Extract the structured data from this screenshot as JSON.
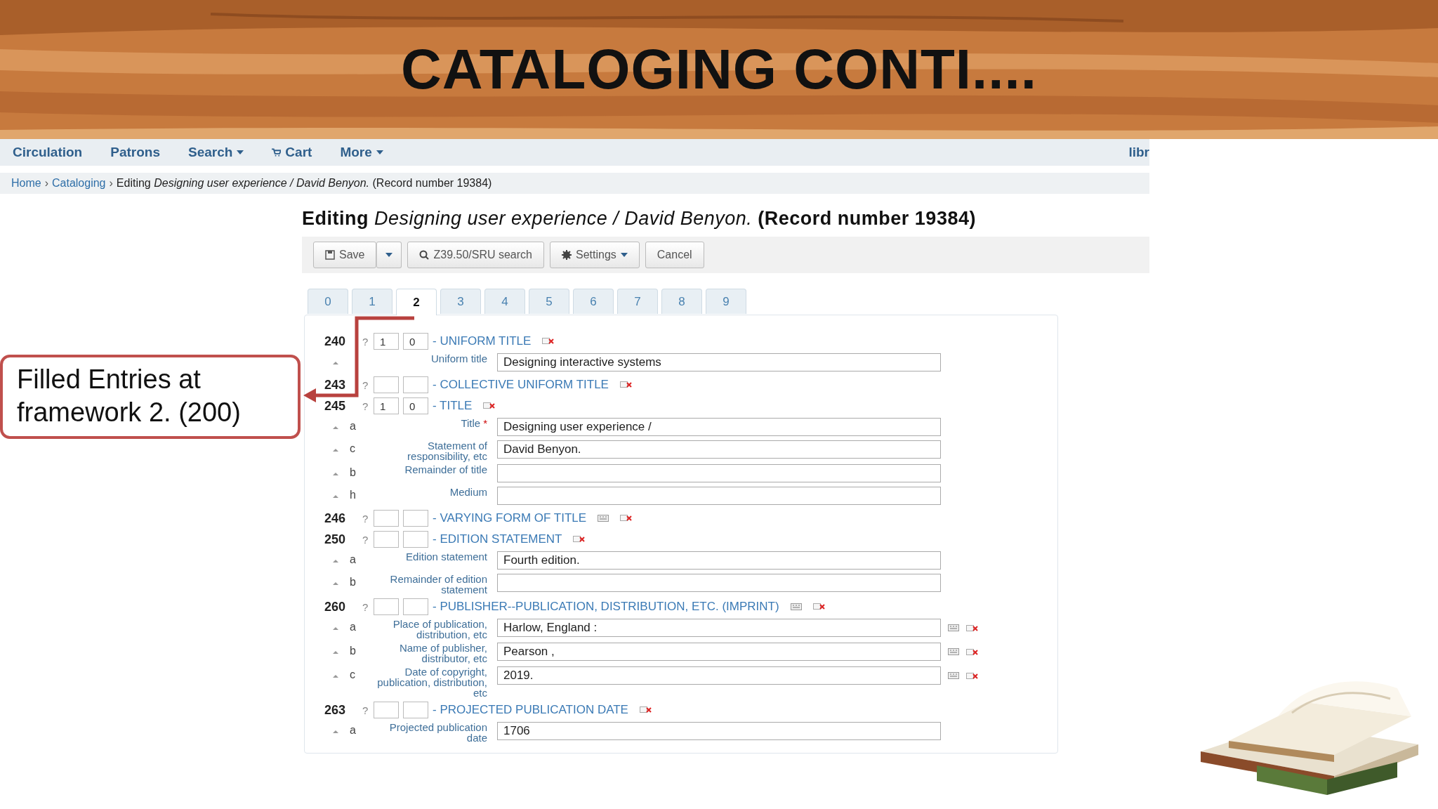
{
  "slide": {
    "title": "CATALOGING CONTI...."
  },
  "nav": {
    "items": [
      {
        "label": "Circulation",
        "kind": "link"
      },
      {
        "label": "Patrons",
        "kind": "link"
      },
      {
        "label": "Search",
        "kind": "menu"
      },
      {
        "label": "Cart",
        "kind": "cart"
      },
      {
        "label": "More",
        "kind": "menu"
      }
    ],
    "right": "libr"
  },
  "breadcrumb": {
    "separator": "›",
    "links": [
      "Home",
      "Cataloging"
    ],
    "current": "Editing *Designing user experience / David Benyon.*  (Record number 19384)"
  },
  "heading": "**Editing** *Designing user experience / David Benyon.* **(Record number 19384)**",
  "toolbar": [
    {
      "kind": "save",
      "label": "Save"
    },
    {
      "kind": "dropdown"
    },
    {
      "kind": "search",
      "label": "Z39.50/SRU search"
    },
    {
      "kind": "settings",
      "label": "Settings"
    },
    {
      "kind": "plain",
      "label": "Cancel"
    }
  ],
  "tabs": [
    {
      "label": "0",
      "selected": false
    },
    {
      "label": "1",
      "selected": false
    },
    {
      "label": "2",
      "selected": true
    },
    {
      "label": "3",
      "selected": false
    },
    {
      "label": "4",
      "selected": false
    },
    {
      "label": "5",
      "selected": false
    },
    {
      "label": "6",
      "selected": false
    },
    {
      "label": "7",
      "selected": false
    },
    {
      "label": "8",
      "selected": false
    },
    {
      "label": "9",
      "selected": false
    }
  ],
  "fields": [
    {
      "tag": "240",
      "help": "?",
      "ind1": "1",
      "ind2": "0",
      "title": "- UNIFORM TITLE",
      "repeatable": false,
      "subfields": [
        {
          "label": "Uniform title",
          "value": "Designing interactive systems",
          "icons": false
        }
      ]
    },
    {
      "tag": "243",
      "help": "?",
      "title": "- COLLECTIVE UNIFORM TITLE",
      "repeatable": false
    },
    {
      "tag": "245",
      "help": "?",
      "ind1": "1",
      "ind2": "0",
      "title": "- TITLE",
      "repeatable": false,
      "subfields": [
        {
          "code": "a",
          "label": "Title",
          "required": "*",
          "value": "Designing user experience /",
          "icons": false
        },
        {
          "code": "c",
          "label": "Statement of responsibility, etc",
          "value": "David Benyon.",
          "icons": false
        },
        {
          "code": "b",
          "label": "Remainder of title",
          "icons": false
        },
        {
          "code": "h",
          "label": "Medium",
          "icons": false
        }
      ]
    },
    {
      "tag": "246",
      "help": "?",
      "title": "- VARYING FORM OF TITLE",
      "repeatable": true
    },
    {
      "tag": "250",
      "help": "?",
      "title": "- EDITION STATEMENT",
      "repeatable": false,
      "subfields": [
        {
          "code": "a",
          "label": "Edition statement",
          "value": "Fourth edition.",
          "icons": false
        },
        {
          "code": "b",
          "label": "Remainder of edition statement",
          "icons": false
        }
      ]
    },
    {
      "tag": "260",
      "help": "?",
      "title": "- PUBLISHER--PUBLICATION, DISTRIBUTION, ETC. (IMPRINT)",
      "repeatable": true,
      "subfields": [
        {
          "code": "a",
          "label": "Place of publication, distribution, etc",
          "value": "Harlow, England :",
          "icons": true
        },
        {
          "code": "b",
          "label": "Name of publisher, distributor, etc",
          "value": "Pearson ,",
          "icons": true
        },
        {
          "code": "c",
          "label": "Date of copyright, publication, distribution, etc",
          "value": "2019.",
          "icons": true
        }
      ]
    },
    {
      "tag": "263",
      "help": "?",
      "title": "- PROJECTED PUBLICATION DATE",
      "repeatable": false,
      "subfields": [
        {
          "code": "a",
          "label": "Projected publication date",
          "value": "1706",
          "icons": false
        }
      ]
    }
  ],
  "callout": {
    "text": "Filled Entries at framework 2. (200)"
  }
}
